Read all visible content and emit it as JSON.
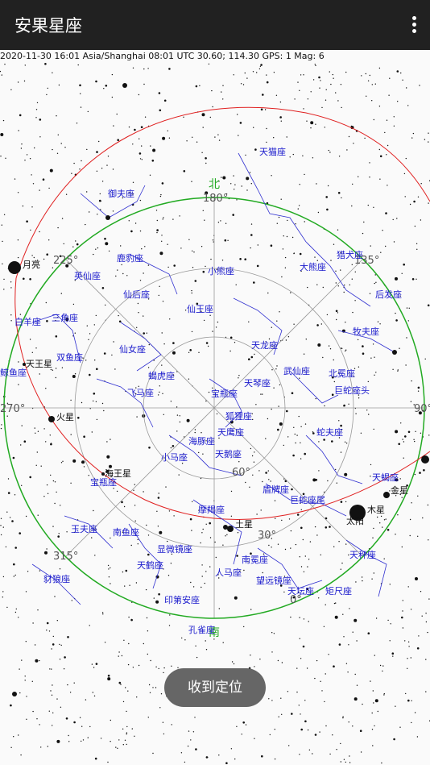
{
  "app": {
    "title": "安果星座"
  },
  "status_line": "2020-11-30  16:01 Asia/Shanghai  08:01 UTC  30.60; 114.30 GPS: 1  Mag: 6",
  "toast": "收到定位",
  "colors": {
    "appbar": "#212121",
    "horizon": "#22aa22",
    "ecliptic": "#e02020",
    "constellation_lines": "#3030d0",
    "constellation_labels": "#1a1acc",
    "grid": "#999999",
    "cardinal": "#22aa22",
    "planet_labels": "#111111"
  },
  "sky": {
    "cardinals": [
      {
        "name": "north",
        "label": "北"
      },
      {
        "name": "south",
        "label": "南"
      }
    ],
    "azimuth_labels": [
      "180°",
      "225°",
      "135°",
      "270°",
      "90°",
      "315°",
      "0°",
      "60°",
      "30°"
    ],
    "constellations": [
      "天猫座",
      "御夫座",
      "鹿豹座",
      "猎犬座",
      "英仙座",
      "小熊座",
      "大熊座",
      "后发座",
      "仙后座",
      "三角座",
      "仙王座",
      "白羊座",
      "牧夫座",
      "天龙座",
      "仙女座",
      "双鱼座",
      "蝎虎座",
      "武仙座",
      "北冕座",
      "巨蛇座头",
      "飞马座",
      "天琴座",
      "宝瓶座",
      "狐狸座",
      "天鹰座",
      "海豚座",
      "蛇夫座",
      "小马座",
      "天鹅座",
      "巨蛇座尾",
      "盾牌座",
      "摩羯座",
      "天蝎座",
      "宝瓶座",
      "玉夫座",
      "南鱼座",
      "显微镜座",
      "天秤座",
      "南冕座",
      "天鹤座",
      "人马座",
      "望远镜座",
      "天坛座",
      "矩尺座",
      "豺狼座",
      "印第安座",
      "孔雀座",
      "鲸鱼座"
    ],
    "bodies": [
      "月亮",
      "天王星",
      "火星",
      "海王星",
      "土星",
      "木星",
      "金星",
      "太阳"
    ]
  }
}
